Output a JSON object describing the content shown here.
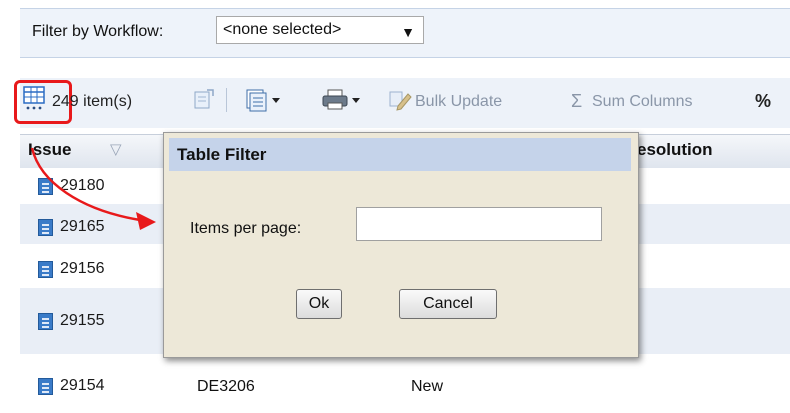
{
  "filter": {
    "label": "Filter by Workflow:",
    "workflow_value": "<none selected>"
  },
  "toolbar": {
    "items_count": "249 item(s)",
    "bulk_update": "Bulk Update",
    "sum_columns": "Sum Columns",
    "percent": "%"
  },
  "table": {
    "headers": {
      "issue": "Issue",
      "resolution": "esolution"
    },
    "rows": [
      {
        "issue": "29180"
      },
      {
        "issue": "29165"
      },
      {
        "issue": "29156"
      },
      {
        "issue": "29155"
      },
      {
        "issue": "29154",
        "col2": "DE3206",
        "col3": "New"
      }
    ]
  },
  "dialog": {
    "title": "Table Filter",
    "items_label": "Items per page:",
    "items_value": "",
    "ok": "Ok",
    "cancel": "Cancel"
  },
  "colors": {
    "highlight": "#e8191b",
    "dialog_title_bg": "#c5d3ea",
    "dialog_bg": "#ede8d8"
  }
}
